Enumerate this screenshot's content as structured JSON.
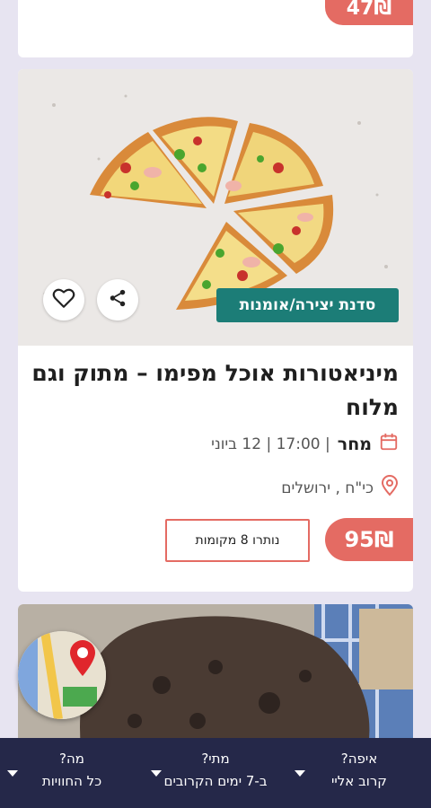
{
  "prev_card": {
    "price": "47₪"
  },
  "main_card": {
    "category": "סדנת יצירה/אומנות",
    "title": "מיניאטורות אוכל מפימו – מתוק וגם מלוח",
    "date_day": "מחר",
    "date_rest": "| 17:00 | 12 ביוני",
    "location": "כי\"ח , ירושלים",
    "spots_label": "נותרו 8 מקומות",
    "price": "95₪",
    "icons": {
      "share": "share-icon",
      "favorite": "heart-icon",
      "calendar": "calendar-icon",
      "location": "pin-icon"
    }
  },
  "bottom_bar": {
    "where_q": "איפה?",
    "where_v": "קרוב אליי",
    "when_q": "מתי?",
    "when_v": "ב-7 ימים הקרובים",
    "what_q": "מה?",
    "what_v": "כל החוויות"
  },
  "colors": {
    "accent": "#e46b63",
    "tag": "#1c7d77",
    "bar": "#252849",
    "bg": "#e7e4f1"
  }
}
